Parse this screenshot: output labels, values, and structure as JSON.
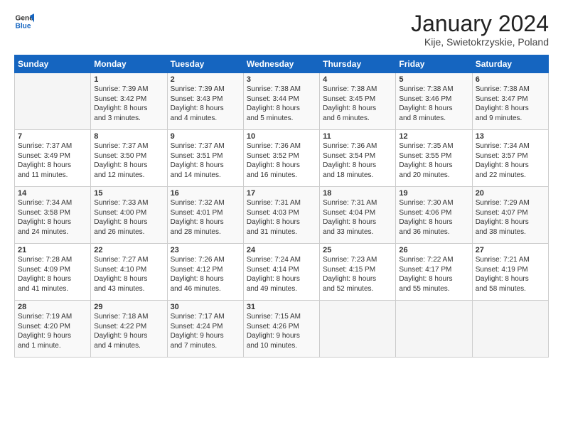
{
  "header": {
    "logo_line1": "General",
    "logo_line2": "Blue",
    "month": "January 2024",
    "location": "Kije, Swietokrzyskie, Poland"
  },
  "days_of_week": [
    "Sunday",
    "Monday",
    "Tuesday",
    "Wednesday",
    "Thursday",
    "Friday",
    "Saturday"
  ],
  "weeks": [
    [
      {
        "day": "",
        "info": ""
      },
      {
        "day": "1",
        "info": "Sunrise: 7:39 AM\nSunset: 3:42 PM\nDaylight: 8 hours\nand 3 minutes."
      },
      {
        "day": "2",
        "info": "Sunrise: 7:39 AM\nSunset: 3:43 PM\nDaylight: 8 hours\nand 4 minutes."
      },
      {
        "day": "3",
        "info": "Sunrise: 7:38 AM\nSunset: 3:44 PM\nDaylight: 8 hours\nand 5 minutes."
      },
      {
        "day": "4",
        "info": "Sunrise: 7:38 AM\nSunset: 3:45 PM\nDaylight: 8 hours\nand 6 minutes."
      },
      {
        "day": "5",
        "info": "Sunrise: 7:38 AM\nSunset: 3:46 PM\nDaylight: 8 hours\nand 8 minutes."
      },
      {
        "day": "6",
        "info": "Sunrise: 7:38 AM\nSunset: 3:47 PM\nDaylight: 8 hours\nand 9 minutes."
      }
    ],
    [
      {
        "day": "7",
        "info": "Sunrise: 7:37 AM\nSunset: 3:49 PM\nDaylight: 8 hours\nand 11 minutes."
      },
      {
        "day": "8",
        "info": "Sunrise: 7:37 AM\nSunset: 3:50 PM\nDaylight: 8 hours\nand 12 minutes."
      },
      {
        "day": "9",
        "info": "Sunrise: 7:37 AM\nSunset: 3:51 PM\nDaylight: 8 hours\nand 14 minutes."
      },
      {
        "day": "10",
        "info": "Sunrise: 7:36 AM\nSunset: 3:52 PM\nDaylight: 8 hours\nand 16 minutes."
      },
      {
        "day": "11",
        "info": "Sunrise: 7:36 AM\nSunset: 3:54 PM\nDaylight: 8 hours\nand 18 minutes."
      },
      {
        "day": "12",
        "info": "Sunrise: 7:35 AM\nSunset: 3:55 PM\nDaylight: 8 hours\nand 20 minutes."
      },
      {
        "day": "13",
        "info": "Sunrise: 7:34 AM\nSunset: 3:57 PM\nDaylight: 8 hours\nand 22 minutes."
      }
    ],
    [
      {
        "day": "14",
        "info": "Sunrise: 7:34 AM\nSunset: 3:58 PM\nDaylight: 8 hours\nand 24 minutes."
      },
      {
        "day": "15",
        "info": "Sunrise: 7:33 AM\nSunset: 4:00 PM\nDaylight: 8 hours\nand 26 minutes."
      },
      {
        "day": "16",
        "info": "Sunrise: 7:32 AM\nSunset: 4:01 PM\nDaylight: 8 hours\nand 28 minutes."
      },
      {
        "day": "17",
        "info": "Sunrise: 7:31 AM\nSunset: 4:03 PM\nDaylight: 8 hours\nand 31 minutes."
      },
      {
        "day": "18",
        "info": "Sunrise: 7:31 AM\nSunset: 4:04 PM\nDaylight: 8 hours\nand 33 minutes."
      },
      {
        "day": "19",
        "info": "Sunrise: 7:30 AM\nSunset: 4:06 PM\nDaylight: 8 hours\nand 36 minutes."
      },
      {
        "day": "20",
        "info": "Sunrise: 7:29 AM\nSunset: 4:07 PM\nDaylight: 8 hours\nand 38 minutes."
      }
    ],
    [
      {
        "day": "21",
        "info": "Sunrise: 7:28 AM\nSunset: 4:09 PM\nDaylight: 8 hours\nand 41 minutes."
      },
      {
        "day": "22",
        "info": "Sunrise: 7:27 AM\nSunset: 4:10 PM\nDaylight: 8 hours\nand 43 minutes."
      },
      {
        "day": "23",
        "info": "Sunrise: 7:26 AM\nSunset: 4:12 PM\nDaylight: 8 hours\nand 46 minutes."
      },
      {
        "day": "24",
        "info": "Sunrise: 7:24 AM\nSunset: 4:14 PM\nDaylight: 8 hours\nand 49 minutes."
      },
      {
        "day": "25",
        "info": "Sunrise: 7:23 AM\nSunset: 4:15 PM\nDaylight: 8 hours\nand 52 minutes."
      },
      {
        "day": "26",
        "info": "Sunrise: 7:22 AM\nSunset: 4:17 PM\nDaylight: 8 hours\nand 55 minutes."
      },
      {
        "day": "27",
        "info": "Sunrise: 7:21 AM\nSunset: 4:19 PM\nDaylight: 8 hours\nand 58 minutes."
      }
    ],
    [
      {
        "day": "28",
        "info": "Sunrise: 7:19 AM\nSunset: 4:20 PM\nDaylight: 9 hours\nand 1 minute."
      },
      {
        "day": "29",
        "info": "Sunrise: 7:18 AM\nSunset: 4:22 PM\nDaylight: 9 hours\nand 4 minutes."
      },
      {
        "day": "30",
        "info": "Sunrise: 7:17 AM\nSunset: 4:24 PM\nDaylight: 9 hours\nand 7 minutes."
      },
      {
        "day": "31",
        "info": "Sunrise: 7:15 AM\nSunset: 4:26 PM\nDaylight: 9 hours\nand 10 minutes."
      },
      {
        "day": "",
        "info": ""
      },
      {
        "day": "",
        "info": ""
      },
      {
        "day": "",
        "info": ""
      }
    ]
  ]
}
